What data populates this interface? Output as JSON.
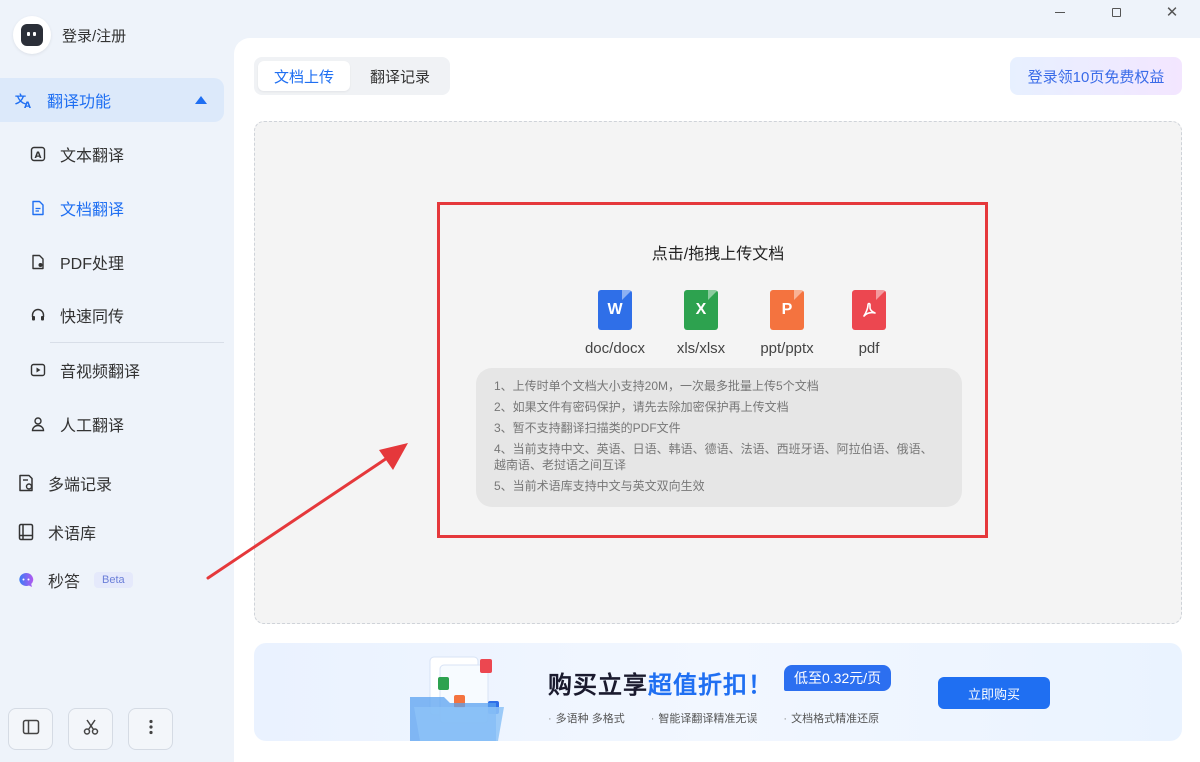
{
  "window": {
    "minimize": "—",
    "maximize": "□",
    "close": "✕"
  },
  "sidebar": {
    "login_label": "登录/注册",
    "group": {
      "label": "翻译功能",
      "icon": "translate-icon"
    },
    "sub_items": [
      {
        "label": "文本翻译",
        "icon": "text-box-icon"
      },
      {
        "label": "文档翻译",
        "icon": "document-icon",
        "active": true
      },
      {
        "label": "PDF处理",
        "icon": "pdf-file-icon"
      },
      {
        "label": "快速同传",
        "icon": "headset-icon"
      },
      {
        "label": "音视频翻译",
        "icon": "video-play-icon"
      },
      {
        "label": "人工翻译",
        "icon": "person-icon"
      }
    ],
    "main_items": [
      {
        "label": "多端记录",
        "icon": "records-icon"
      },
      {
        "label": "术语库",
        "icon": "book-icon"
      },
      {
        "label": "秒答",
        "icon": "ai-chat-icon",
        "badge": "Beta"
      }
    ],
    "bottom_buttons": [
      "layout-icon",
      "scissors-icon",
      "more-vertical-icon"
    ]
  },
  "main": {
    "tabs": [
      {
        "label": "文档上传",
        "active": true
      },
      {
        "label": "翻译记录",
        "active": false
      }
    ],
    "promo_label": "登录领10页免费权益",
    "upload": {
      "title": "点击/拖拽上传文档",
      "file_types": [
        {
          "label": "doc/docx",
          "glyph": "W",
          "color": "#2f6fe8"
        },
        {
          "label": "xls/xlsx",
          "glyph": "X",
          "color": "#2da24f"
        },
        {
          "label": "ppt/pptx",
          "glyph": "P",
          "color": "#f4733f"
        },
        {
          "label": "pdf",
          "glyph": "⅄",
          "color": "#ec4750"
        }
      ],
      "notes": [
        "1、上传时单个文档大小支持20M，一次最多批量上传5个文档",
        "2、如果文件有密码保护，请先去除加密保护再上传文档",
        "3、暂不支持翻译扫描类的PDF文件",
        "4、当前支持中文、英语、日语、韩语、德语、法语、西班牙语、阿拉伯语、俄语、越南语、老挝语之间互译",
        "5、当前术语库支持中文与英文双向生效"
      ]
    },
    "banner": {
      "title_part1": "购买立享",
      "title_part2": "超值折扣！",
      "price_badge": "低至0.32元/页",
      "features": [
        "多语种 多格式",
        "智能译翻译精准无误",
        "文档格式精准还原"
      ],
      "buy_label": "立即购买"
    }
  },
  "colors": {
    "accent": "#1f6ff2",
    "highlight_box": "#e5383b"
  }
}
